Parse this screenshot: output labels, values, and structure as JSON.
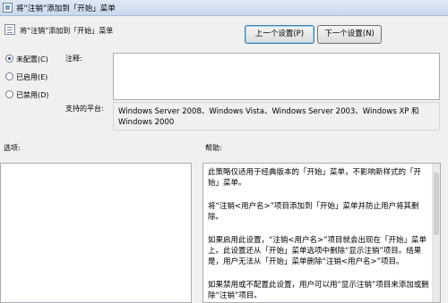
{
  "window": {
    "title": "将“注销”添加到「开始」菜单"
  },
  "header": {
    "title": "将“注销”添加到「开始」菜单"
  },
  "nav": {
    "prev_label": "上一个设置(P)",
    "next_label": "下一个设置(N)"
  },
  "radios": [
    {
      "label": "未配置(C)",
      "checked": true
    },
    {
      "label": "已启用(E)",
      "checked": false
    },
    {
      "label": "已禁用(D)",
      "checked": false
    }
  ],
  "labels": {
    "comment": "注释:",
    "platform": "支持的平台:",
    "options": "选项:",
    "help": "帮助:"
  },
  "platform": {
    "text": "Windows Server 2008、Windows Vista、Windows Server 2003、Windows XP 和 Windows 2000"
  },
  "comment": {
    "value": ""
  },
  "help": {
    "paragraphs": [
      "此策略仅适用于经典版本的「开始」菜单，不影响新样式的「开始」菜单。",
      "将“注销<用户名>”项目添加到「开始」菜单并防止用户将其删除。",
      "如果启用此设置，“注销<用户名>”项目就会出现在「开始」菜单上。此设置还从「开始」菜单选项中删除“显示注销”项目。结果是，用户无法从「开始」菜单删除“注销<用户名>”项目。",
      "如果禁用或不配置此设置，用户可以用“显示注销”项目来添加或删除“注销”项目。"
    ]
  }
}
